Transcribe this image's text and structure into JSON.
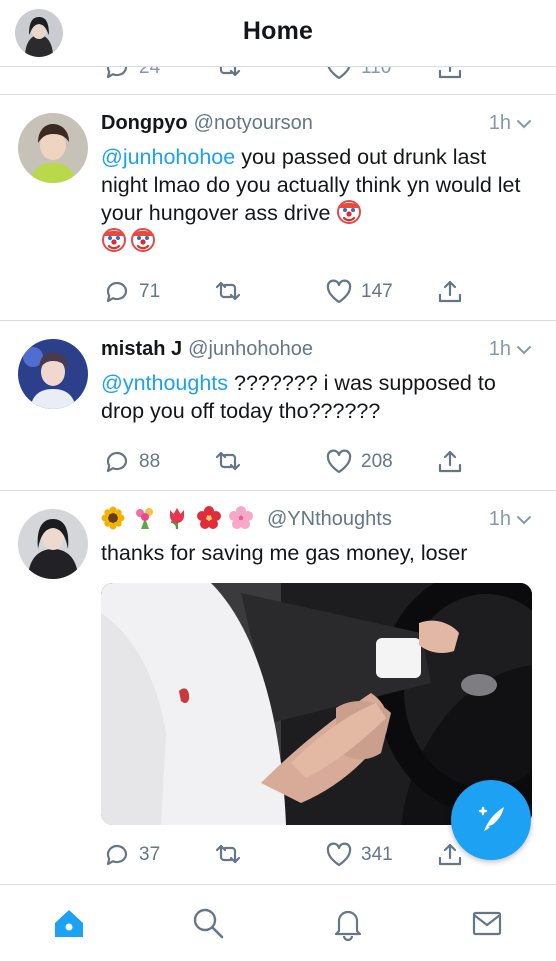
{
  "header": {
    "title": "Home",
    "avatar_icon": "profile-avatar"
  },
  "previous_tweet": {
    "reply_count": "24",
    "like_count": "110"
  },
  "tweets": [
    {
      "name": "Dongpyo",
      "handle": "@notyourson",
      "time": "1h",
      "mention": "@junhohohoe",
      "text": " you passed out drunk last night lmao do you actually think yn would let your hungover ass drive ",
      "emoji": [
        "clown-face",
        "clown-face",
        "clown-face"
      ],
      "replies": "71",
      "likes": "147"
    },
    {
      "name": "mistah J",
      "handle": "@junhohohoe",
      "time": "1h",
      "mention": "@ynthoughts",
      "text": " ??????? i was supposed to drop you off today tho??????",
      "replies": "88",
      "likes": "208"
    },
    {
      "name_emoji": [
        "sunflower",
        "bouquet",
        "tulip",
        "hibiscus",
        "cherry-blossom"
      ],
      "handle": "@YNthoughts",
      "time": "1h",
      "text": "thanks for saving me gas money, loser",
      "media": "car-interior-holding-hands-photo",
      "replies": "37",
      "likes": "341"
    }
  ],
  "tabbar": {
    "items": [
      "home-icon",
      "search-icon",
      "notifications-icon",
      "messages-icon"
    ]
  },
  "colors": {
    "accent": "#1da1f2",
    "muted": "#657786",
    "border": "#d9dee3"
  }
}
